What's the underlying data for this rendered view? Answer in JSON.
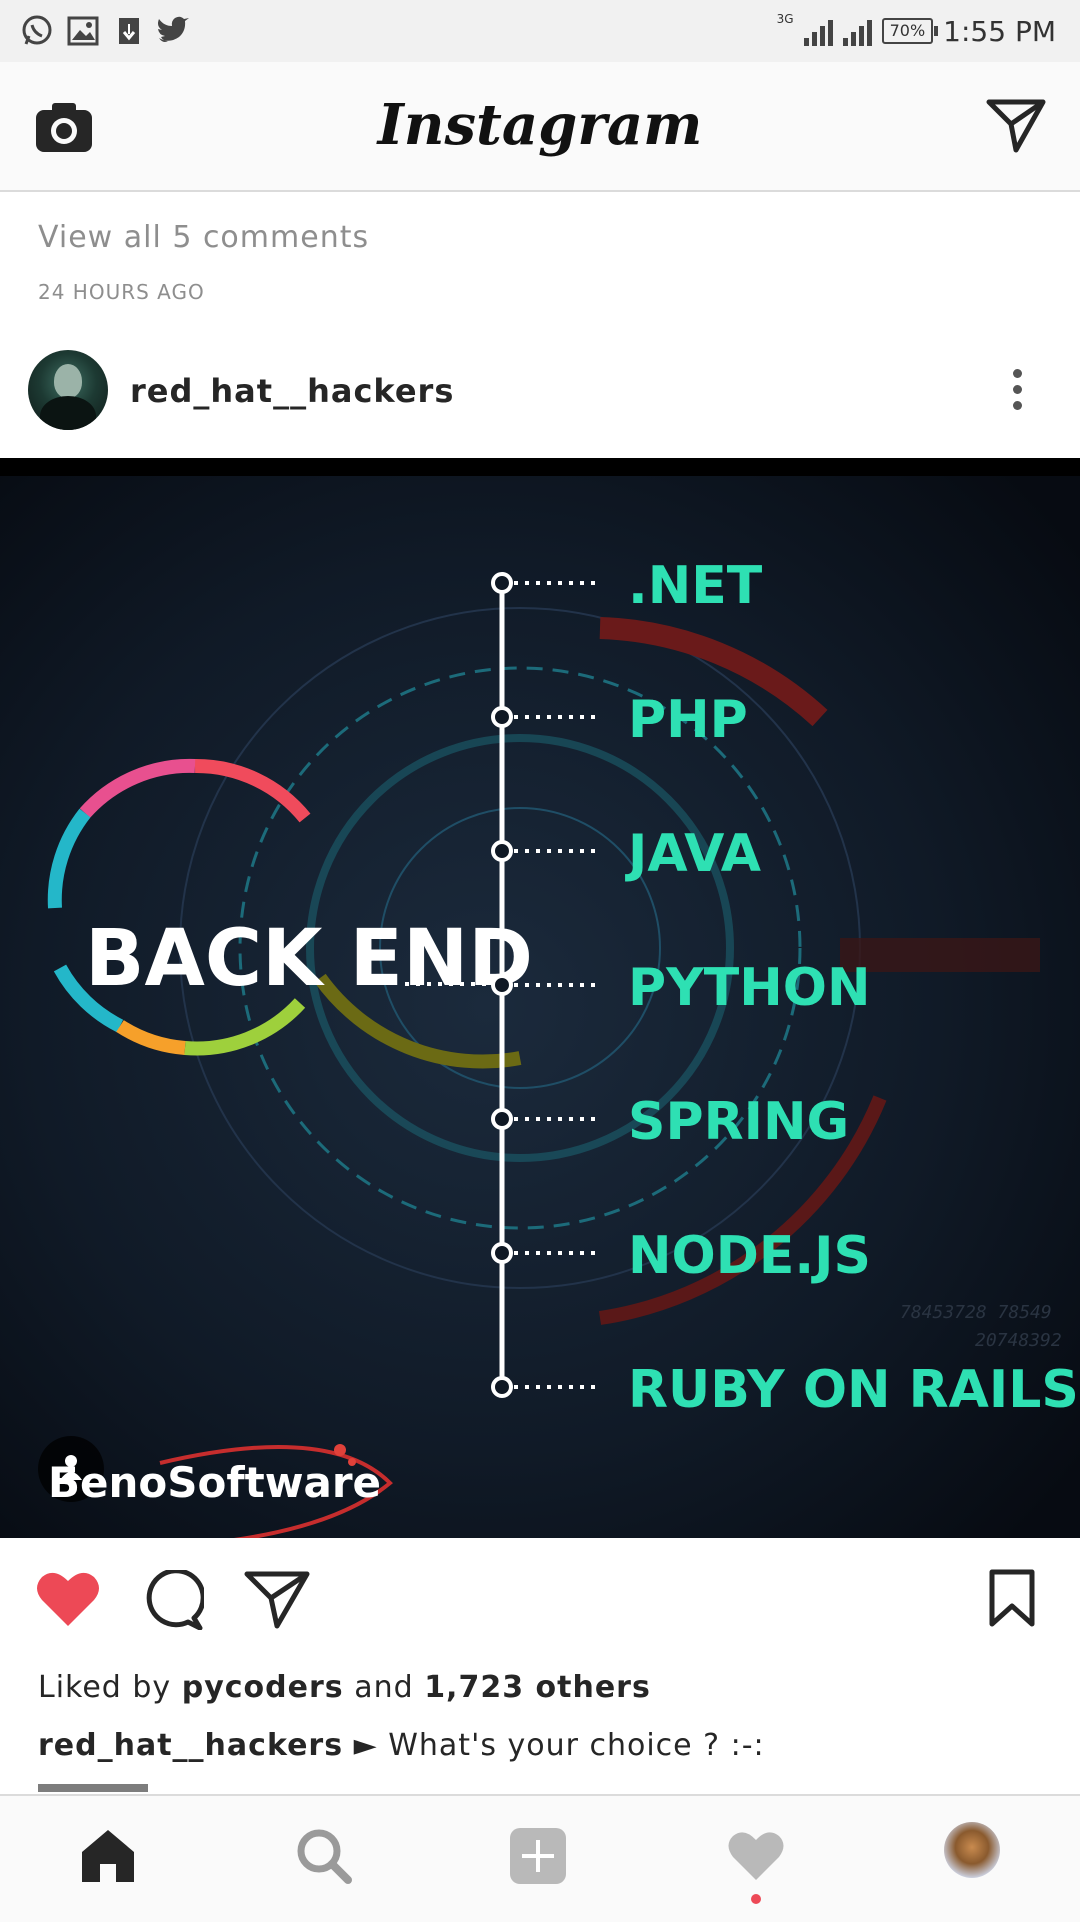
{
  "status_bar": {
    "time": "1:55 PM",
    "battery": "70%",
    "network": "3G",
    "left_icons": [
      "whatsapp-icon",
      "gallery-icon",
      "download-icon",
      "twitter-icon"
    ]
  },
  "header": {
    "title": "Instagram",
    "left_icon": "camera-icon",
    "right_icon": "direct-message-icon"
  },
  "previous_post": {
    "view_comments": "View all 5 comments",
    "timestamp": "24 HOURS AGO"
  },
  "post": {
    "username": "red_hat__hackers",
    "image": {
      "headline": "BACK END",
      "items": [
        ".NET",
        "PHP",
        "JAVA",
        "PYTHON",
        "SPRING",
        "NODE.JS",
        "RUBY ON RAILS"
      ],
      "brand": "БenoSoftware",
      "accent_color": "#2ee0b3"
    },
    "likes": {
      "prefix": "Liked by",
      "user": "pycoders",
      "middle": "and",
      "count": "1,723 others"
    },
    "caption": {
      "username": "red_hat__hackers",
      "text": "► What's your choice ? :-:"
    }
  },
  "bottom_nav": {
    "items": [
      "home-icon",
      "search-icon",
      "add-post-icon",
      "activity-icon",
      "profile-avatar"
    ],
    "like_color": "#ed4956"
  }
}
